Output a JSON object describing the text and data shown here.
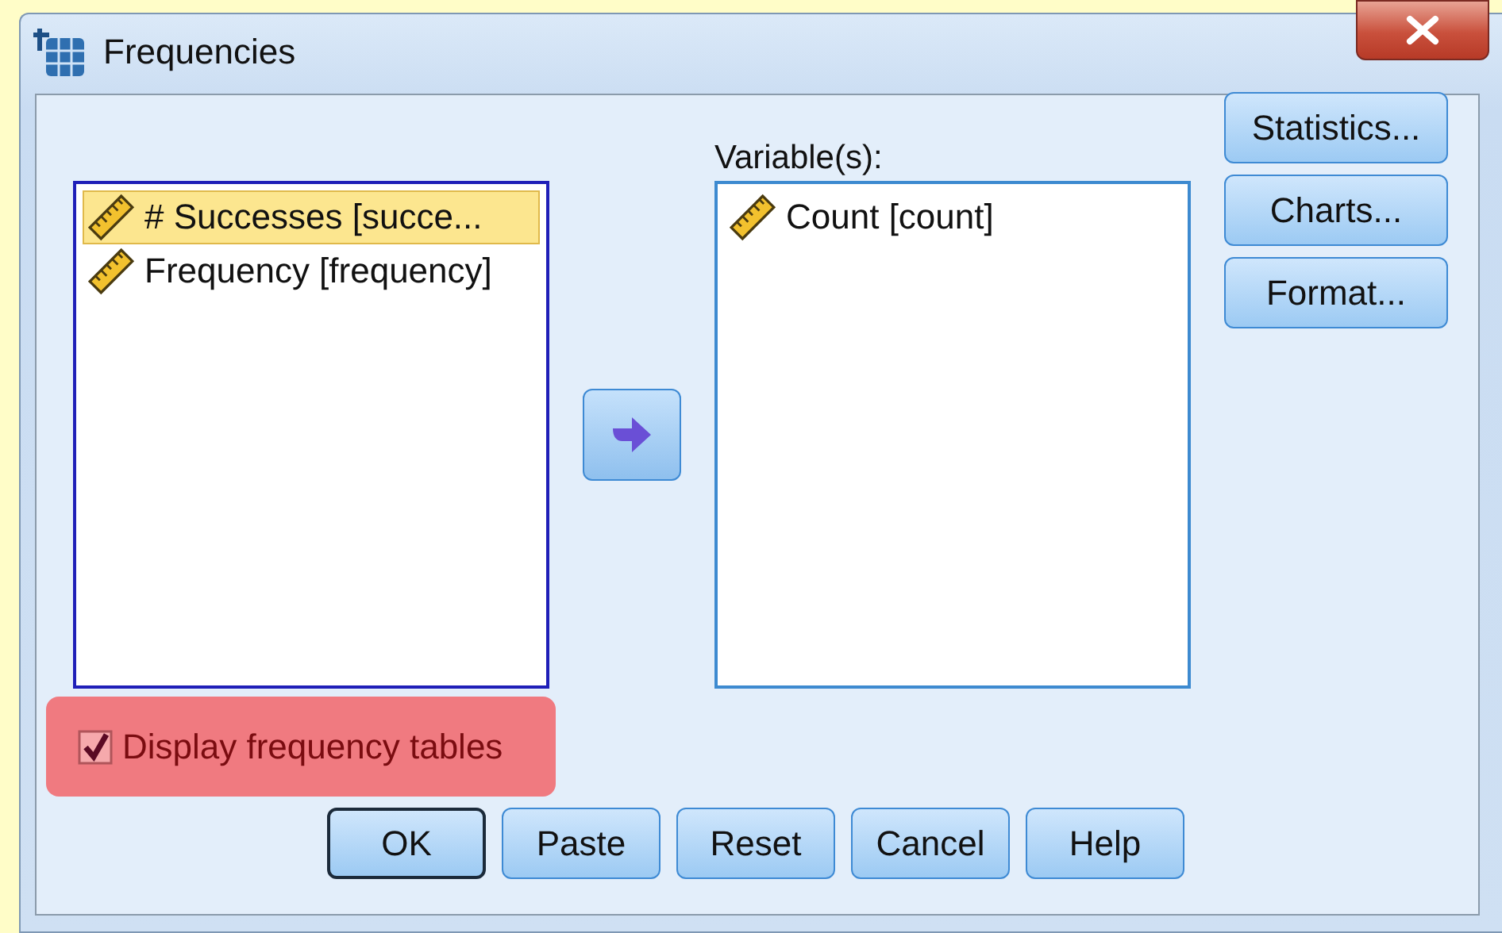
{
  "window": {
    "title": "Frequencies"
  },
  "source_list": {
    "items": [
      {
        "label": "# Successes [succe...",
        "selected": true
      },
      {
        "label": "Frequency [frequency]",
        "selected": false
      }
    ]
  },
  "variables": {
    "label": "Variable(s):",
    "items": [
      {
        "label": "Count [count]",
        "selected": false
      }
    ]
  },
  "side_buttons": [
    "Statistics...",
    "Charts...",
    "Format..."
  ],
  "display_checkbox": {
    "label": "Display frequency tables",
    "checked": true
  },
  "buttons": [
    {
      "label": "OK",
      "default": true
    },
    {
      "label": "Paste",
      "default": false
    },
    {
      "label": "Reset",
      "default": false
    },
    {
      "label": "Cancel",
      "default": false
    },
    {
      "label": "Help",
      "default": false
    }
  ]
}
